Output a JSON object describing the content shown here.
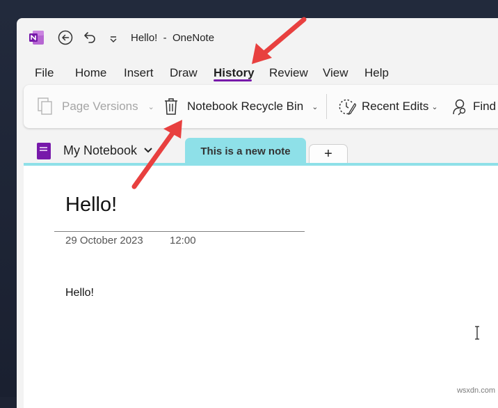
{
  "window": {
    "title": "Hello!  -  OneNote"
  },
  "menu": {
    "tabs": [
      {
        "label": "File"
      },
      {
        "label": "Home"
      },
      {
        "label": "Insert"
      },
      {
        "label": "Draw"
      },
      {
        "label": "History",
        "active": true
      },
      {
        "label": "Review"
      },
      {
        "label": "View"
      },
      {
        "label": "Help"
      }
    ]
  },
  "ribbon": {
    "page_versions": "Page Versions",
    "recycle_bin": "Notebook Recycle Bin",
    "recent_edits": "Recent Edits",
    "find": "Find"
  },
  "notebook": {
    "name": "My Notebook",
    "section_tab": "This is a new note",
    "add_tab": "+"
  },
  "page": {
    "title": "Hello!",
    "date": "29 October 2023",
    "time": "12:00",
    "body": "Hello!"
  },
  "colors": {
    "accent": "#7719aa",
    "section": "#8ee0e8",
    "annotation_arrow": "#e8403f"
  },
  "watermark": "wsxdn.com"
}
